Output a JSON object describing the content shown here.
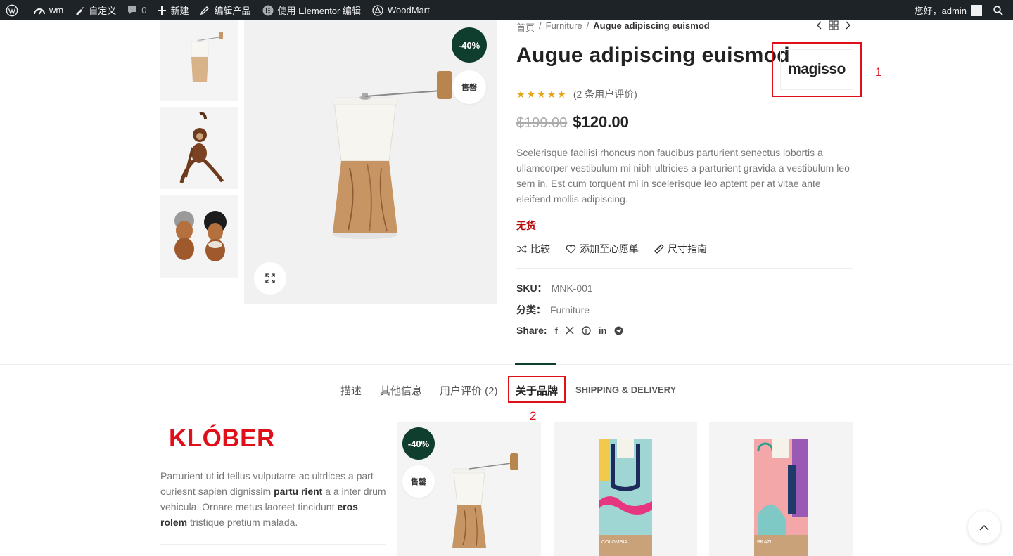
{
  "admin_bar": {
    "site_name": "wm",
    "customize": "自定义",
    "comments_count": "0",
    "new": "新建",
    "edit_product": "编辑产品",
    "elementor": "使用 Elementor 编辑",
    "woodmart": "WoodMart",
    "greeting": "您好，admin"
  },
  "breadcrumb": {
    "home": "首页",
    "sep": "/",
    "category": "Furniture",
    "current": "Augue adipiscing euismod"
  },
  "product": {
    "title": "Augue adipiscing euismod",
    "brand_logo_text": "magisso",
    "rating_stars": 5,
    "rating_text": "(2 条用户评价)",
    "old_price": "$199.00",
    "price": "$120.00",
    "description": "Scelerisque facilisi rhoncus non faucibus parturient senectus lobortis a ullamcorper vestibulum mi nibh ultricies a parturient gravida a vestibulum leo sem in. Est cum torquent mi in scelerisque leo aptent per at vitae ante eleifend mollis adipiscing.",
    "stock": "无货",
    "badge_discount": "-40%",
    "badge_sold": "售罄"
  },
  "actions": {
    "compare": "比较",
    "wishlist": "添加至心愿单",
    "size_guide": "尺寸指南"
  },
  "meta": {
    "sku_label": "SKU：",
    "sku_value": "MNK-001",
    "category_label": "分类：",
    "category_value": "Furniture",
    "share_label": "Share:"
  },
  "share_icons": [
    "facebook-icon",
    "x-icon",
    "pinterest-icon",
    "linkedin-icon",
    "telegram-icon"
  ],
  "annotations": {
    "one": "1",
    "two": "2"
  },
  "tabs": {
    "description": "描述",
    "additional_info": "其他信息",
    "reviews": "用户评价 (2)",
    "brand": "关于品牌",
    "shipping": "SHIPPING & DELIVERY"
  },
  "brand_tab": {
    "logo_text": "KLÓBER",
    "desc_part1": "Parturient ut id tellus vulputatre ac ultrlices a part ouriesnt sapien dignissim ",
    "desc_bold1": "partu rient",
    "desc_part2": " a a inter drum vehicula. Ornare metus laoreet tincidunt ",
    "desc_bold2": "eros rolem",
    "desc_part3": " tristique pretium malada."
  },
  "cards": {
    "card1_discount": "-40%",
    "card1_sold": "售罄",
    "card2_label": "COLOMBIA",
    "card3_label": "BRAZIL"
  },
  "colors": {
    "accent": "#0f3d2e",
    "annotation_red": "#e0101a",
    "stock_red": "#b50b0b",
    "star": "#e3a519"
  }
}
